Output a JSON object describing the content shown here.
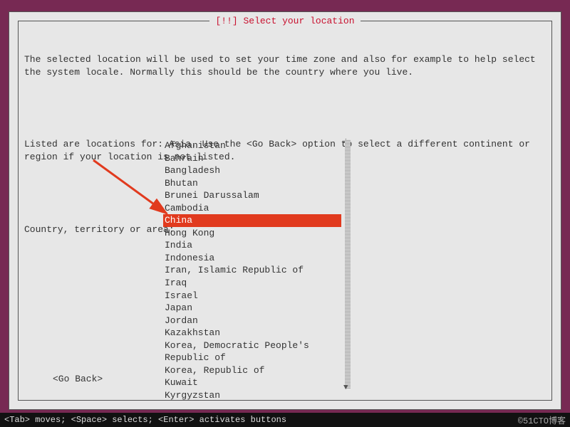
{
  "title": "[!!] Select your location",
  "paragraph1": "The selected location will be used to set your time zone and also for example to help select the system locale. Normally this should be the country where you live.",
  "paragraph2": "Listed are locations for: Asia. Use the <Go Back> option to select a different continent or region if your location is not listed.",
  "prompt": "Country, territory or area:",
  "items": [
    "Afghanistan",
    "Bahrain",
    "Bangladesh",
    "Bhutan",
    "Brunei Darussalam",
    "Cambodia",
    "China",
    "Hong Kong",
    "India",
    "Indonesia",
    "Iran, Islamic Republic of",
    "Iraq",
    "Israel",
    "Japan",
    "Jordan",
    "Kazakhstan",
    "Korea, Democratic People's Republic of",
    "Korea, Republic of",
    "Kuwait",
    "Kyrgyzstan"
  ],
  "selected_index": 6,
  "go_back_label": "<Go Back>",
  "status_hint": "<Tab> moves; <Space> selects; <Enter> activates buttons",
  "watermark": "©51CTO博客"
}
